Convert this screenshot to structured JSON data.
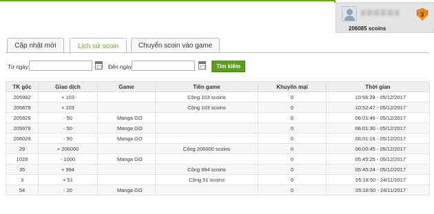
{
  "account": {
    "balance": "206085 scoins",
    "badge_icon": "shield-badge-icon",
    "rank_text": "3"
  },
  "tabs": [
    {
      "label": "Cập nhật mới",
      "active": false
    },
    {
      "label": "Lịch sử scoin",
      "active": true
    },
    {
      "label": "Chuyển scoin vào game",
      "active": false
    }
  ],
  "filter": {
    "from_label": "Từ ngày:",
    "to_label": "Đến ngày:",
    "from_value": "",
    "to_value": "",
    "search_label": "Tìm kiếm"
  },
  "table": {
    "headers": [
      "TK gốc",
      "Giao dịch",
      "Game",
      "Tiền game",
      "Khuyến mại",
      "Thời gian"
    ],
    "rows": [
      [
        "205982",
        "+ 103",
        "",
        "Cộng 103 scoins",
        "0",
        "10:56:28 - 05/12/2017"
      ],
      [
        "205879",
        "+ 103",
        "",
        "Cộng 103 scoins",
        "0",
        "10:52:47 - 05/12/2017"
      ],
      [
        "205929",
        "- 50",
        "Manga GO",
        "",
        "0",
        "06:01:46 - 05/12/2017"
      ],
      [
        "205979",
        "- 50",
        "Manga GO",
        "",
        "0",
        "06:01:30 - 05/12/2017"
      ],
      [
        "206029",
        "- 50",
        "Manga GO",
        "",
        "0",
        "06:01:16 - 05/12/2017"
      ],
      [
        "29",
        "+ 206000",
        "",
        "Cộng 206000 scoins",
        "0",
        "06:00:45 - 05/12/2017"
      ],
      [
        "1029",
        "- 1000",
        "Manga GO",
        "",
        "0",
        "05:45:25 - 05/12/2017"
      ],
      [
        "35",
        "+ 994",
        "",
        "Cộng 994 scoins",
        "0",
        "05:45:24 - 05/12/2017"
      ],
      [
        "3",
        "+ 51",
        "",
        "Cộng 51 scoins",
        "0",
        "05:18:50 - 24/11/2017"
      ],
      [
        "54",
        "- 20",
        "Manga GO",
        "",
        "0",
        "05:18:50 - 24/11/2017"
      ]
    ]
  },
  "colors": {
    "accent": "#6aa521",
    "button": "#5c9f1c",
    "header_bg": "#eeeeee"
  }
}
